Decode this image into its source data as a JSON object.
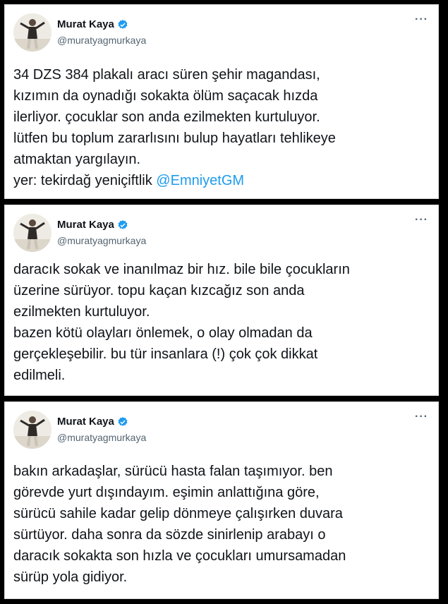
{
  "tweets": [
    {
      "author_name": "Murat Kaya",
      "handle": "@muratyagmurkaya",
      "more_glyph": "···",
      "text": "34 DZS 384 plakalı aracı süren şehir magandası,\nkızımın da oynadığı sokakta ölüm saçacak hızda\nilerliyor. çocuklar son anda ezilmekten kurtuluyor.\nlütfen bu toplum zararlısını bulup hayatları tehlikeye\natmaktan yargılayın.\nyer: tekirdağ yeniçiftlik ",
      "mention": "@EmniyetGM"
    },
    {
      "author_name": "Murat Kaya",
      "handle": "@muratyagmurkaya",
      "more_glyph": "···",
      "text": "daracık sokak ve inanılmaz bir hız. bile bile çocukların\nüzerine sürüyor. topu kaçan kızcağız son anda\nezilmekten kurtuluyor.\nbazen kötü olayları önlemek, o olay olmadan da\ngerçekleşebilir. bu tür insanlara (!) çok çok dikkat\nedilmeli."
    },
    {
      "author_name": "Murat Kaya",
      "handle": "@muratyagmurkaya",
      "more_glyph": "···",
      "text": "bakın arkadaşlar, sürücü hasta falan taşımıyor. ben\ngörevde yurt dışındayım. eşimin anlattığına göre,\nsürücü sahile kadar gelip dönmeye çalışırken duvara\nsürtüyor. daha sonra da sözde sinirlenip arabayı o\ndaracık sokakta son hızla ve çocukları umursamadan\nsürüp yola gidiyor."
    }
  ],
  "colors": {
    "background": "#000000",
    "verified_blue": "#1d9bf0",
    "mention_blue": "#1d9bf0",
    "text": "#0f1419",
    "secondary_text": "#536471"
  }
}
